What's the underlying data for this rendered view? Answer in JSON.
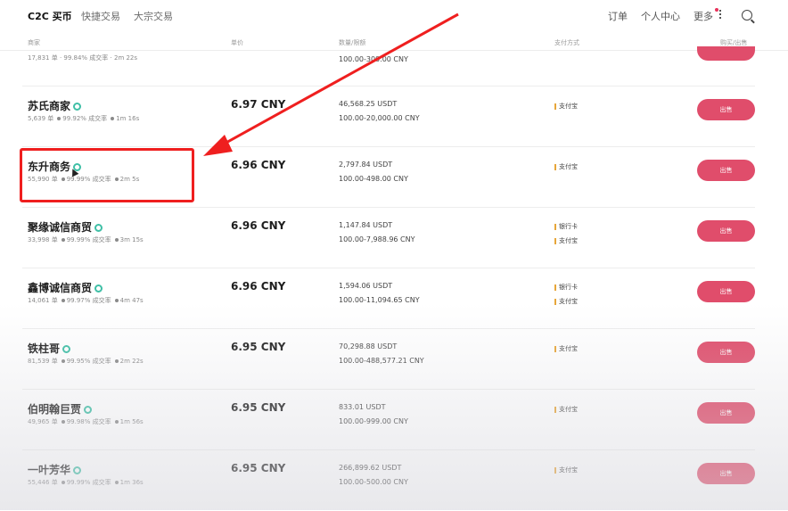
{
  "nav": {
    "tabs": [
      {
        "label": "C2C 买币"
      },
      {
        "label": "快捷交易"
      },
      {
        "label": "大宗交易"
      }
    ],
    "right": {
      "orders": "订单",
      "personal_center": "个人中心",
      "more": "更多"
    }
  },
  "table": {
    "headers": {
      "merchant": "商家",
      "price": "单价",
      "amount_limit": "数量/限额",
      "payment": "支付方式",
      "action": "购买/出售"
    },
    "partial_top": {
      "stats": "17,831 单 · 99.84% 成交率 · 2m 22s",
      "limit": "100.00-300.00 CNY"
    },
    "rows": [
      {
        "merchant": "苏氏商家",
        "orders": "5,639 单",
        "rate": "99.92% 成交率",
        "time": "1m 16s",
        "price": "6.97 CNY",
        "amount": "46,568.25 USDT",
        "limit": "100.00-20,000.00 CNY",
        "payments": [
          "支付宝"
        ],
        "action": "出售"
      },
      {
        "merchant": "东升商务",
        "orders": "55,990 单",
        "rate": "99.99% 成交率",
        "time": "2m 5s",
        "price": "6.96 CNY",
        "amount": "2,797.84 USDT",
        "limit": "100.00-498.00 CNY",
        "payments": [
          "支付宝"
        ],
        "action": "出售"
      },
      {
        "merchant": "聚缘诚信商贸",
        "orders": "33,998 单",
        "rate": "99.99% 成交率",
        "time": "3m 15s",
        "price": "6.96 CNY",
        "amount": "1,147.84 USDT",
        "limit": "100.00-7,988.96 CNY",
        "payments": [
          "银行卡",
          "支付宝"
        ],
        "action": "出售"
      },
      {
        "merchant": "鑫博诚信商贸",
        "orders": "14,061 单",
        "rate": "99.97% 成交率",
        "time": "4m 47s",
        "price": "6.96 CNY",
        "amount": "1,594.06 USDT",
        "limit": "100.00-11,094.65 CNY",
        "payments": [
          "银行卡",
          "支付宝"
        ],
        "action": "出售"
      },
      {
        "merchant": "铁柱哥",
        "orders": "81,539 单",
        "rate": "99.95% 成交率",
        "time": "2m 22s",
        "price": "6.95 CNY",
        "amount": "70,298.88 USDT",
        "limit": "100.00-488,577.21 CNY",
        "payments": [
          "支付宝"
        ],
        "action": "出售"
      },
      {
        "merchant": "伯明翰巨贾",
        "orders": "49,965 单",
        "rate": "99.98% 成交率",
        "time": "1m 56s",
        "price": "6.95 CNY",
        "amount": "833.01 USDT",
        "limit": "100.00-999.00 CNY",
        "payments": [
          "支付宝"
        ],
        "action": "出售"
      },
      {
        "merchant": "一叶芳华",
        "orders": "55,446 单",
        "rate": "99.99% 成交率",
        "time": "1m 36s",
        "price": "6.95 CNY",
        "amount": "266,899.62 USDT",
        "limit": "100.00-500.00 CNY",
        "payments": [
          "支付宝"
        ],
        "action": "出售"
      }
    ]
  },
  "colors": {
    "accent": "#e04d6b",
    "annotation": "#ef1f1f",
    "verified": "#3fbfa6"
  }
}
